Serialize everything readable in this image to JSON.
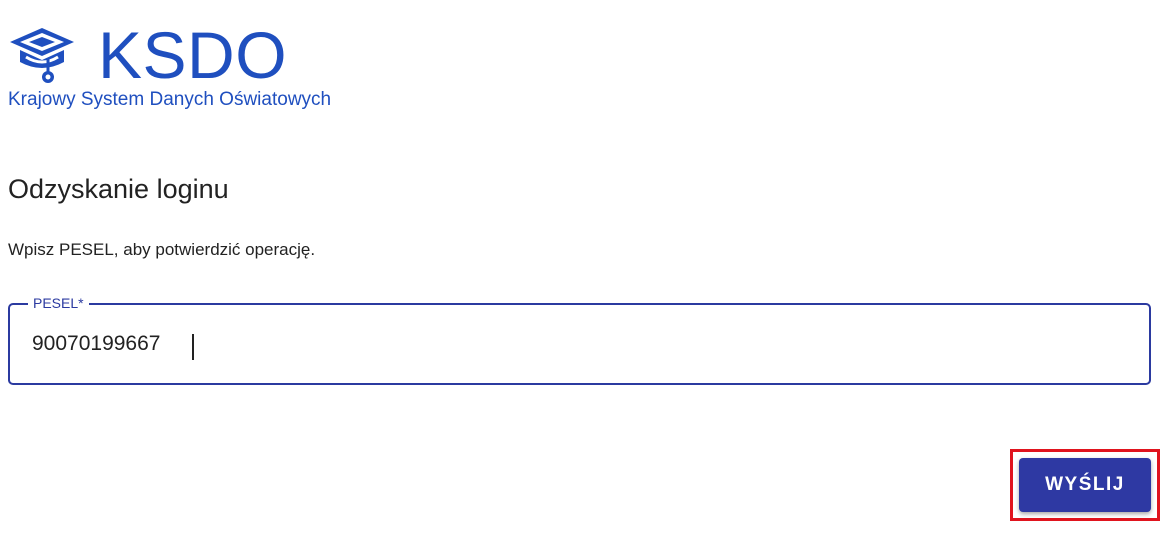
{
  "header": {
    "title": "KSDO",
    "subtitle": "Krajowy System Danych Oświatowych",
    "logo_icon": "graduation-cap-icon",
    "brand_color": "#1f4fbf"
  },
  "main": {
    "title": "Odzyskanie loginu",
    "instruction": "Wpisz PESEL, aby potwierdzić operację."
  },
  "form": {
    "pesel_label": "PESEL*",
    "pesel_value": "90070199667",
    "field_color": "#2b3aa0"
  },
  "actions": {
    "submit_label": "WYŚLIJ",
    "button_color": "#2e39a3",
    "highlight_color": "#e0141e"
  }
}
